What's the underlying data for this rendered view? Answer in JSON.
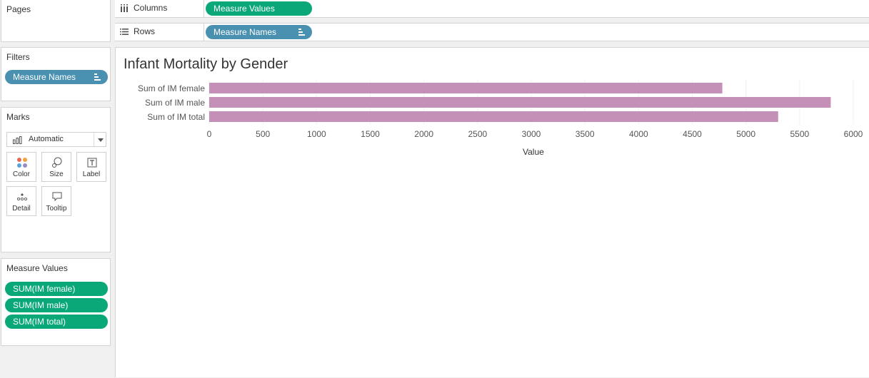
{
  "cards": {
    "pages": {
      "title": "Pages"
    },
    "filters": {
      "title": "Filters",
      "pill": "Measure Names"
    },
    "marks": {
      "title": "Marks",
      "type_value": "Automatic",
      "buttons": [
        {
          "label": "Color",
          "icon": "color-icon"
        },
        {
          "label": "Size",
          "icon": "size-icon"
        },
        {
          "label": "Label",
          "icon": "label-icon"
        },
        {
          "label": "Detail",
          "icon": "detail-icon"
        },
        {
          "label": "Tooltip",
          "icon": "tooltip-icon"
        }
      ]
    },
    "measure_values": {
      "title": "Measure Values",
      "pills": [
        "SUM(IM female)",
        "SUM(IM male)",
        "SUM(IM total)"
      ]
    }
  },
  "shelves": {
    "columns": {
      "label": "Columns",
      "pill": "Measure Values"
    },
    "rows": {
      "label": "Rows",
      "pill": "Measure Names"
    }
  },
  "colors": {
    "bar": "#c490b8",
    "green_pill": "#0aa879",
    "blue_pill": "#4a90b0"
  },
  "chart_data": {
    "type": "bar",
    "orientation": "horizontal",
    "title": "Infant Mortality by Gender",
    "categories": [
      "Sum of IM female",
      "Sum of IM male",
      "Sum of IM total"
    ],
    "values": [
      4780,
      5790,
      5300
    ],
    "xlabel": "Value",
    "xlim": [
      0,
      6000
    ],
    "xticks": [
      "0",
      "500",
      "1000",
      "1500",
      "2000",
      "2500",
      "3000",
      "3500",
      "4000",
      "4500",
      "5000",
      "5500",
      "6000"
    ],
    "grid": true
  }
}
